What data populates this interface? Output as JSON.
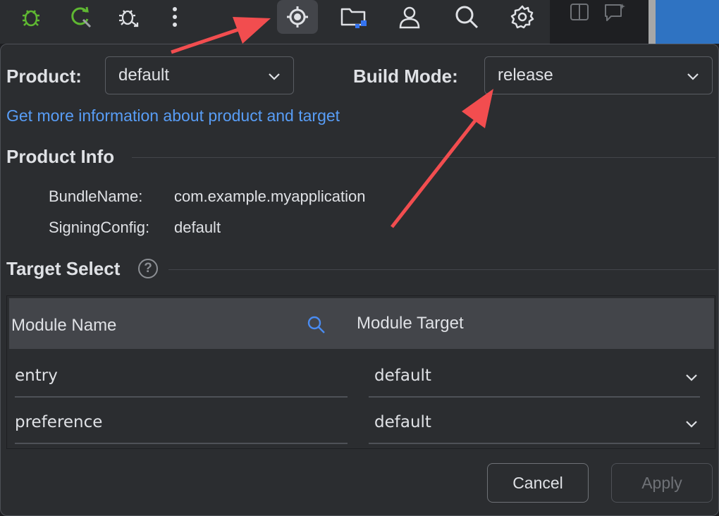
{
  "toolbar": {
    "icons": [
      "bug-icon",
      "refresh-debug-icon",
      "debug-attach-icon",
      "more-vertical-icon",
      "target-icon",
      "folder-icon",
      "profile-icon",
      "search-icon",
      "settings-icon"
    ]
  },
  "dialog": {
    "product_label": "Product:",
    "product_value": "default",
    "build_mode_label": "Build Mode:",
    "build_mode_value": "release",
    "info_link": "Get more information about product and target",
    "product_info": {
      "title": "Product Info",
      "bundle_name_label": "BundleName:",
      "bundle_name_value": "com.example.myapplication",
      "signing_config_label": "SigningConfig:",
      "signing_config_value": "default"
    },
    "target_select": {
      "title": "Target Select",
      "help_glyph": "?",
      "columns": [
        "Module Name",
        "Module Target"
      ],
      "rows": [
        {
          "module": "entry",
          "target": "default"
        },
        {
          "module": "preference",
          "target": "default"
        }
      ]
    },
    "buttons": {
      "cancel": "Cancel",
      "apply": "Apply"
    }
  },
  "colors": {
    "panel_bg": "#2b2d30",
    "toolbar_bg": "#2b2d30",
    "link": "#589df6",
    "accent_green": "#5fb832",
    "annotation_arrow": "#f24d4f",
    "disabled_text": "#6f7277"
  }
}
